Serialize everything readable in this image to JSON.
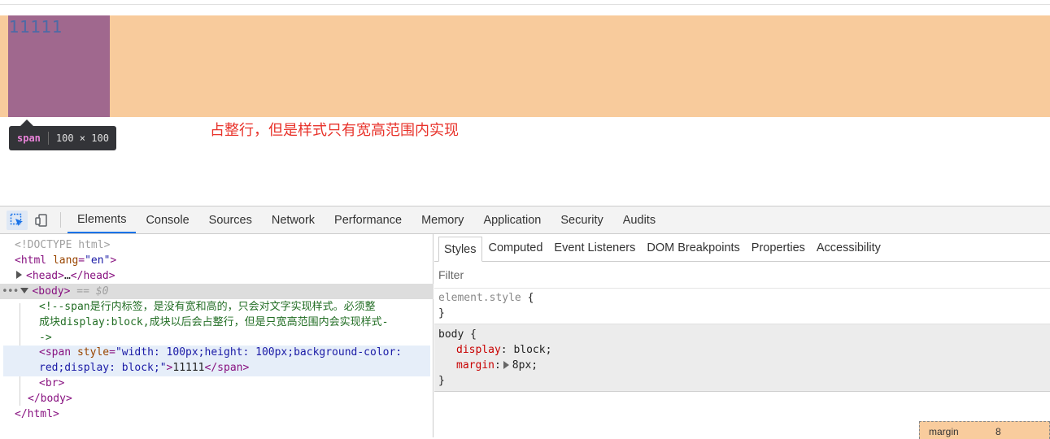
{
  "page": {
    "span_text": "11111",
    "note": "占整行，但是样式只有宽高范围内实现",
    "tooltip": {
      "tag": "span",
      "dims": "100 × 100"
    }
  },
  "devtools": {
    "tabs": [
      "Elements",
      "Console",
      "Sources",
      "Network",
      "Performance",
      "Memory",
      "Application",
      "Security",
      "Audits"
    ],
    "active_tab": "Elements",
    "dom": {
      "doctype": "<!DOCTYPE html>",
      "html_open_tag": "<html",
      "html_attr": "lang",
      "html_attr_val": "\"en\"",
      "head_open": "<head>",
      "head_ellipsis": "…",
      "head_close": "</head>",
      "body_open": "<body>",
      "body_marker": " == $0",
      "comment_line1": "<!--span是行内标签，是没有宽和高的，只会对文字实现样式。必须整",
      "comment_line2": "成块display:block,成块以后会占整行，但是只宽高范围内会实现样式-",
      "comment_line3": "->",
      "span_open": "<span",
      "span_attr": "style",
      "span_val_1": "\"width: 100px;height: 100px;background-color: ",
      "span_val_2": "red;display: block;\"",
      "span_text": "11111",
      "span_close": "</span>",
      "br": "<br>",
      "body_close": "</body>",
      "html_close": "</html>"
    },
    "styles": {
      "tabs": [
        "Styles",
        "Computed",
        "Event Listeners",
        "DOM Breakpoints",
        "Properties",
        "Accessibility"
      ],
      "active_tab": "Styles",
      "filter_placeholder": "Filter",
      "element_style": {
        "selector": "element.style",
        "open": " {",
        "close": "}"
      },
      "body_rule": {
        "selector": "body",
        "open": " {",
        "props": [
          {
            "name": "display",
            "value": "block"
          },
          {
            "name": "margin",
            "value": "8px"
          }
        ],
        "close": "}"
      },
      "box_model": {
        "label": "margin",
        "value": "8"
      }
    }
  },
  "colors": {
    "span_content": "#a0688e",
    "margin_highlight": "#f8cb9c",
    "note_red": "#e8322a",
    "tab_accent": "#1a73e8"
  }
}
